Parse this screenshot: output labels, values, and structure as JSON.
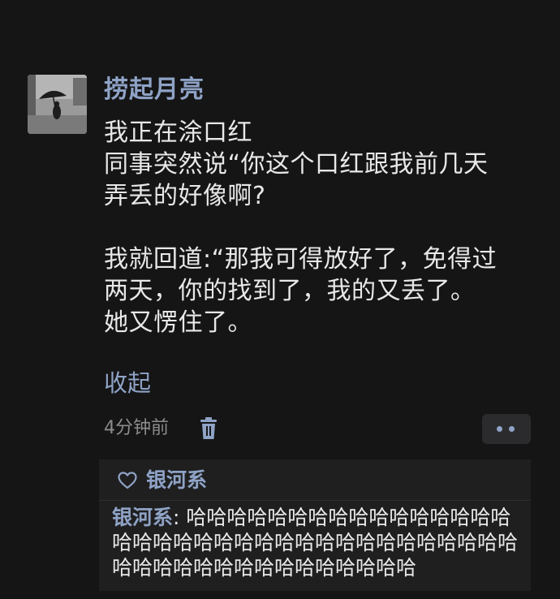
{
  "post": {
    "author": "捞起月亮",
    "body_lines": [
      "我正在涂口红",
      "同事突然说“你这个口红跟我前几天",
      "弄丢的好像啊?",
      "",
      "我就回道:“那我可得放好了，免得过",
      "两天，你的找到了，我的又丢了。",
      "她又愣住了。"
    ],
    "collapse_label": "收起",
    "timestamp": "4分钟前"
  },
  "icons": {
    "avatar": "avatar-umbrella-photo",
    "delete": "trash-icon",
    "more": "more-dots-icon",
    "like": "heart-outline-icon"
  },
  "likes": {
    "names": "银河系"
  },
  "comment": {
    "author": "银河系",
    "separator": ": ",
    "text": "哈哈哈哈哈哈哈哈哈哈哈哈哈哈哈哈哈哈哈哈哈哈哈哈哈哈哈哈哈哈哈哈哈哈哈哈哈哈哈哈哈哈哈哈哈哈哈哈哈哈哈"
  },
  "colors": {
    "background": "#151516",
    "accent_name": "#8fa3c6",
    "text_primary": "#e8e8e8",
    "text_secondary": "#8c8c8c",
    "panel": "#1f1f20"
  }
}
